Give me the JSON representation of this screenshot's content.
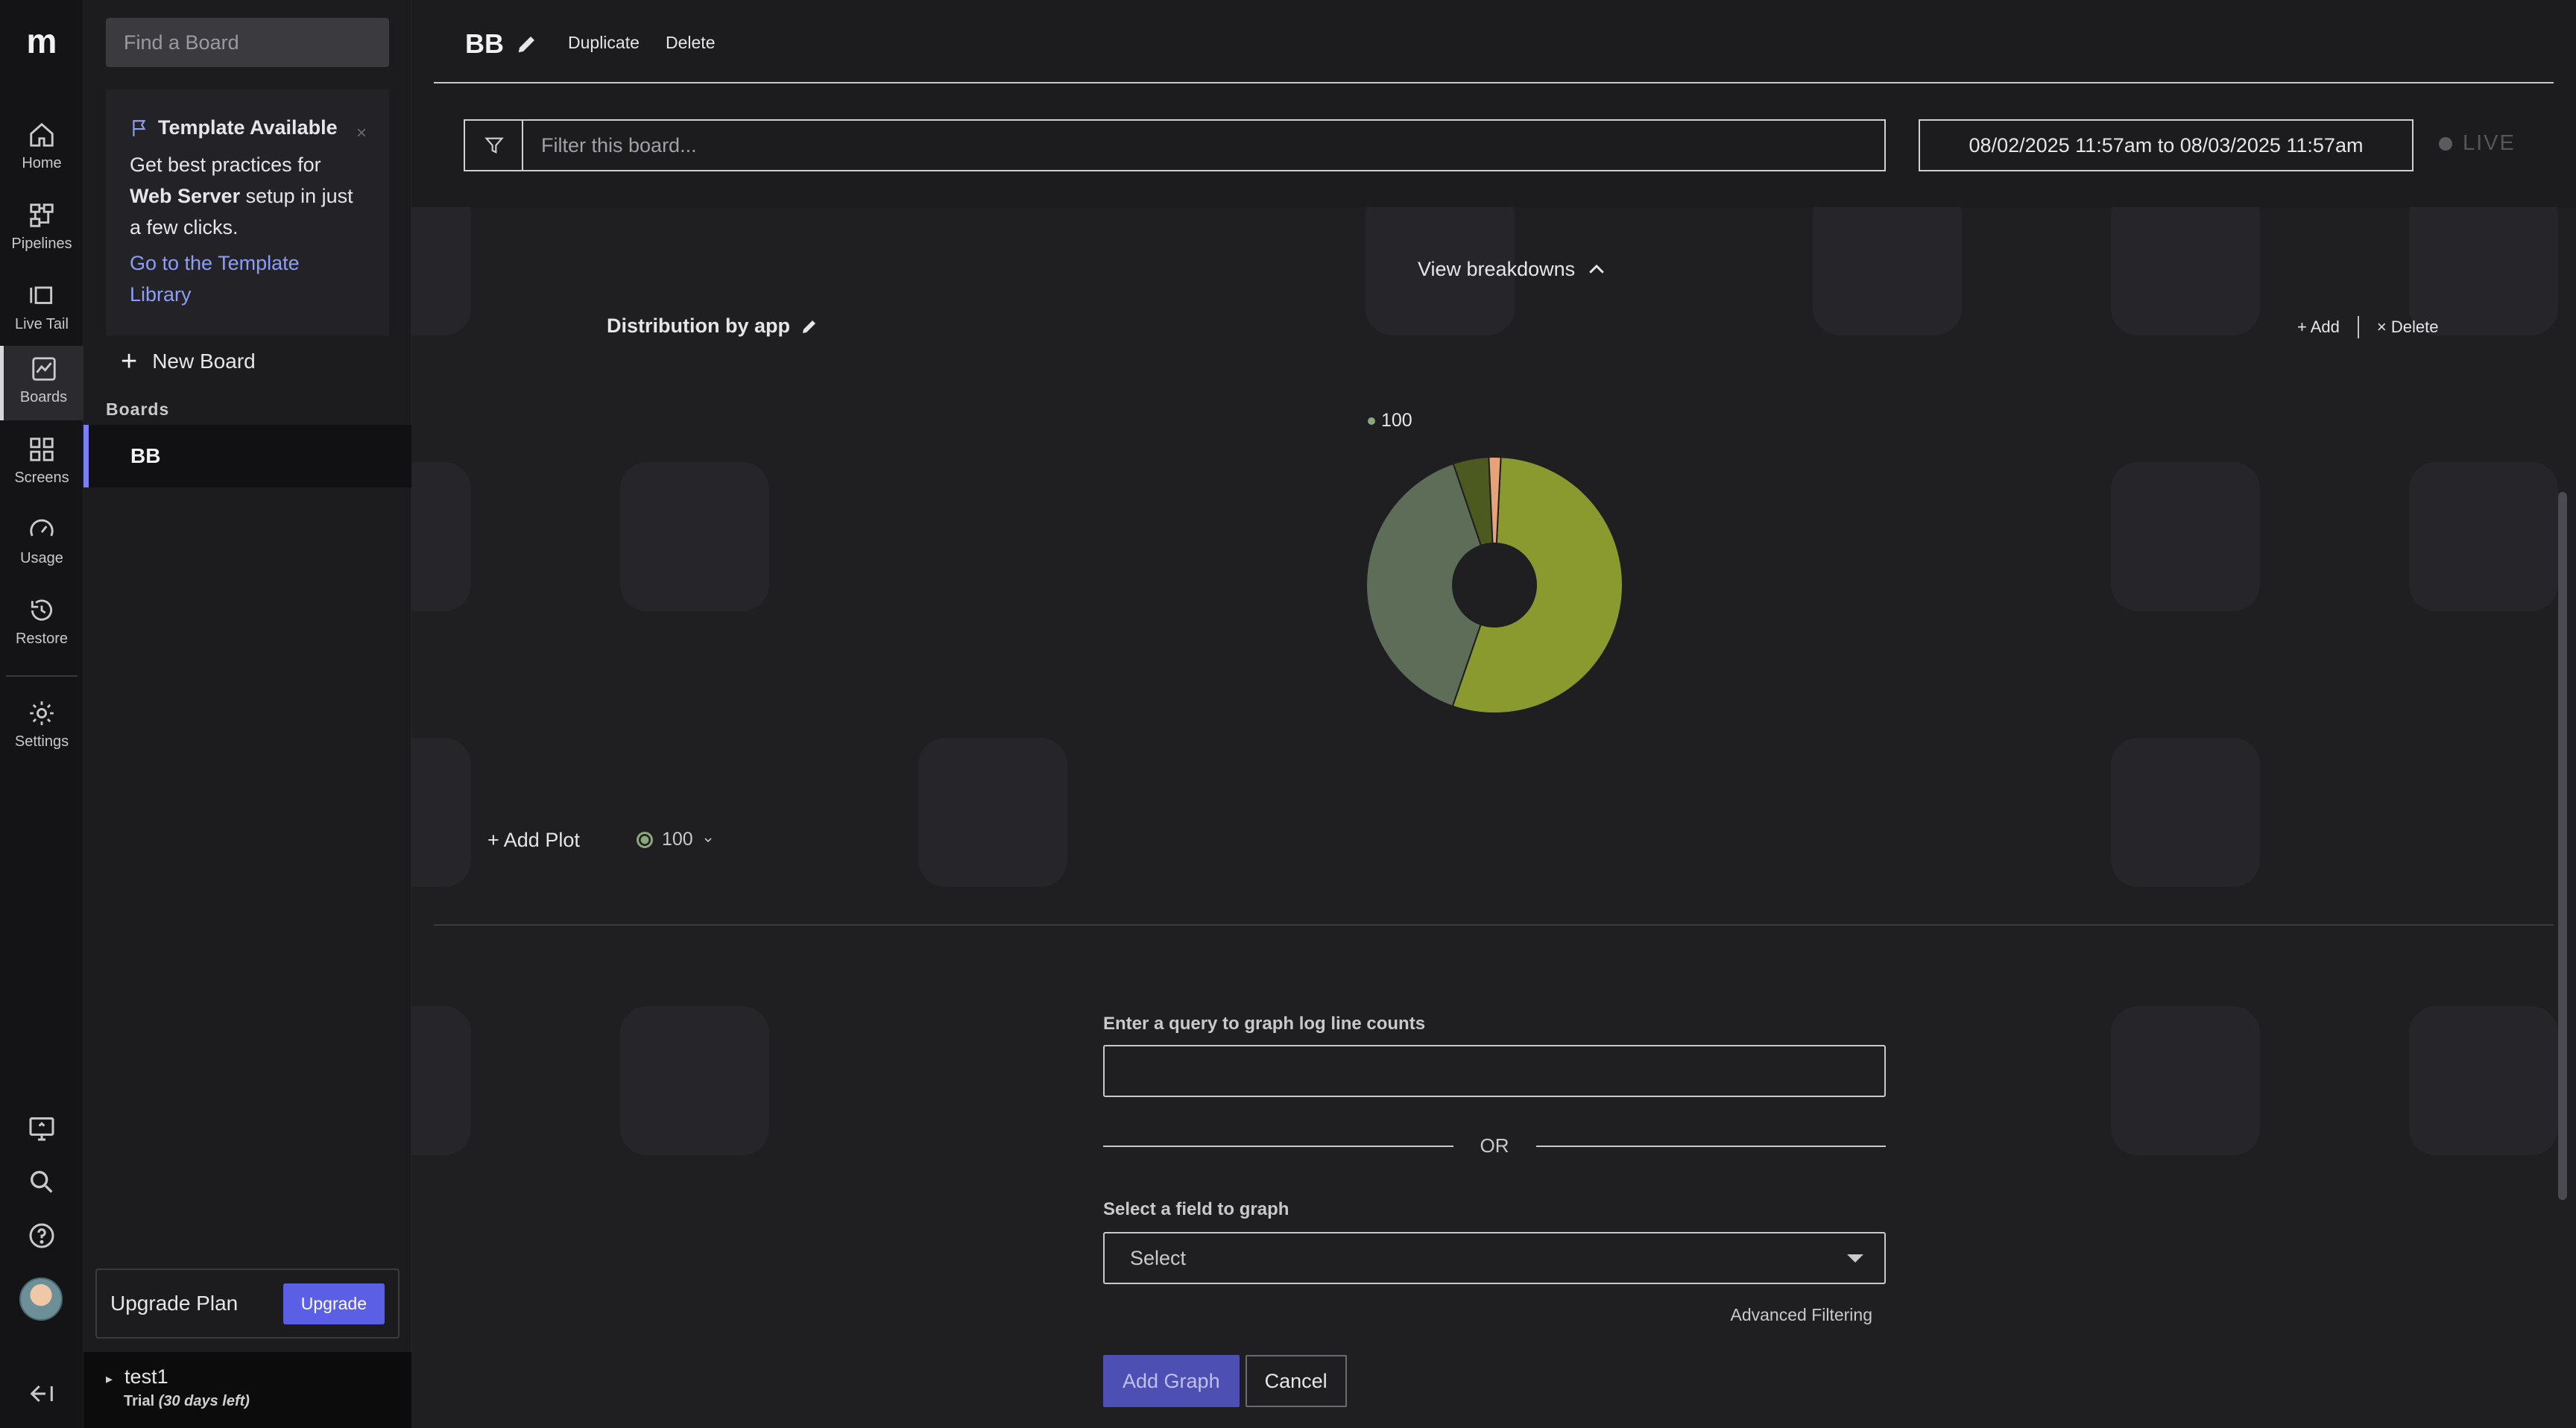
{
  "app": {
    "logo": "m"
  },
  "rail": {
    "items": [
      {
        "label": "Home",
        "icon": "home-icon"
      },
      {
        "label": "Pipelines",
        "icon": "pipelines-icon"
      },
      {
        "label": "Live Tail",
        "icon": "live-tail-icon"
      },
      {
        "label": "Boards",
        "icon": "boards-icon"
      },
      {
        "label": "Screens",
        "icon": "screens-icon"
      },
      {
        "label": "Usage",
        "icon": "gauge-icon"
      },
      {
        "label": "Restore",
        "icon": "restore-icon"
      },
      {
        "label": "Settings",
        "icon": "gear-icon"
      }
    ],
    "bottom_icons": [
      "monitor-icon",
      "search-icon",
      "help-icon",
      "collapse-icon"
    ]
  },
  "sidebar": {
    "search_placeholder": "Find a Board",
    "template_card": {
      "title": "Template Available",
      "body_prefix": "Get best practices for ",
      "body_bold": "Web Server",
      "body_suffix": " setup in just a few clicks.",
      "close": "×",
      "link": "Go to the Template Library"
    },
    "new_board": "New Board",
    "boards_label": "Boards",
    "boards": [
      "BB"
    ],
    "upgrade": {
      "label": "Upgrade Plan",
      "button": "Upgrade"
    },
    "account": {
      "name": "test1",
      "trial_prefix": "Trial ",
      "trial_days": "(30 days left)"
    }
  },
  "header": {
    "title": "BB",
    "duplicate": "Duplicate",
    "delete": "Delete",
    "filter_placeholder": "Filter this board...",
    "date_range": "08/02/2025 11:57am to 08/03/2025 11:57am",
    "live": "LIVE"
  },
  "panel": {
    "view_breakdowns": "View breakdowns",
    "title": "Distribution by app",
    "add": "+ Add",
    "delete": "× Delete",
    "add_plot": "+ Add Plot",
    "series_chip": "100"
  },
  "chart_data": {
    "type": "pie",
    "style": "donut",
    "legend": [
      "100"
    ],
    "legend_position": "top",
    "slices": [
      {
        "value": 54.5,
        "color": "#8a9a2e"
      },
      {
        "value": 39.5,
        "color": "#5d6d58"
      },
      {
        "value": 4.5,
        "color": "#4d5a1f"
      },
      {
        "value": 1.5,
        "color": "#e8a27a"
      }
    ]
  },
  "form": {
    "query_label": "Enter a query to graph log line counts",
    "query_value": "",
    "or": "OR",
    "field_label": "Select a field to graph",
    "select_value": "Select",
    "advanced": "Advanced Filtering",
    "add_graph": "Add Graph",
    "cancel": "Cancel"
  },
  "colors": {
    "accent": "#5b5fe6",
    "link": "#8c9ef6",
    "background": "#1f1f22"
  }
}
